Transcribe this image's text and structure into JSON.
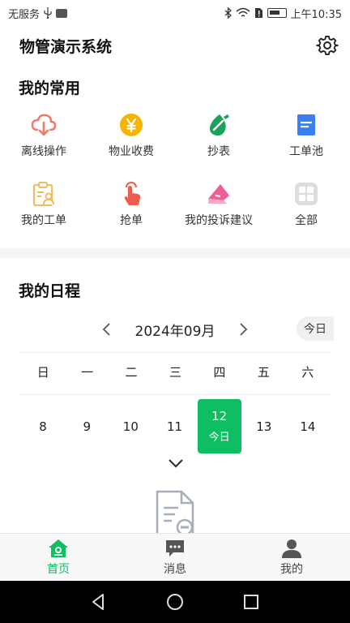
{
  "status_bar": {
    "carrier": "无服务",
    "usb_icon": "usb-icon",
    "time": "上午10:35"
  },
  "header": {
    "title": "物管演示系统",
    "settings_icon": "gear-icon"
  },
  "favorites": {
    "title": "我的常用",
    "items": [
      {
        "label": "离线操作",
        "icon": "cloud-download-icon",
        "color": "#f07b6c"
      },
      {
        "label": "物业收费",
        "icon": "yuan-coin-icon",
        "color": "#f5b400"
      },
      {
        "label": "抄表",
        "icon": "pen-drop-icon",
        "color": "#1aa25a"
      },
      {
        "label": "工单池",
        "icon": "document-icon",
        "color": "#3a7ff0"
      },
      {
        "label": "我的工单",
        "icon": "clipboard-user-icon",
        "color": "#f0bd63"
      },
      {
        "label": "抢单",
        "icon": "tap-hand-icon",
        "color": "#ef5b4e"
      },
      {
        "label": "我的投诉建议",
        "icon": "complaint-icon",
        "color": "#ee5f9a"
      },
      {
        "label": "全部",
        "icon": "grid-icon",
        "color": "#c8c8c8"
      }
    ]
  },
  "schedule": {
    "title": "我的日程",
    "month": "2024年09月",
    "today_button": "今日",
    "weekdays": [
      "日",
      "一",
      "二",
      "三",
      "四",
      "五",
      "六"
    ],
    "days": [
      {
        "day": "8",
        "sub": ""
      },
      {
        "day": "9",
        "sub": ""
      },
      {
        "day": "10",
        "sub": ""
      },
      {
        "day": "11",
        "sub": ""
      },
      {
        "day": "12",
        "sub": "今日",
        "selected": true
      },
      {
        "day": "13",
        "sub": ""
      },
      {
        "day": "14",
        "sub": ""
      }
    ],
    "accent_color": "#0fbd62"
  },
  "tabs": [
    {
      "label": "首页",
      "icon": "home-icon",
      "active": true
    },
    {
      "label": "消息",
      "icon": "message-icon",
      "active": false
    },
    {
      "label": "我的",
      "icon": "person-icon",
      "active": false
    }
  ],
  "system_nav": [
    "back-icon",
    "home-circle-icon",
    "recents-icon"
  ]
}
